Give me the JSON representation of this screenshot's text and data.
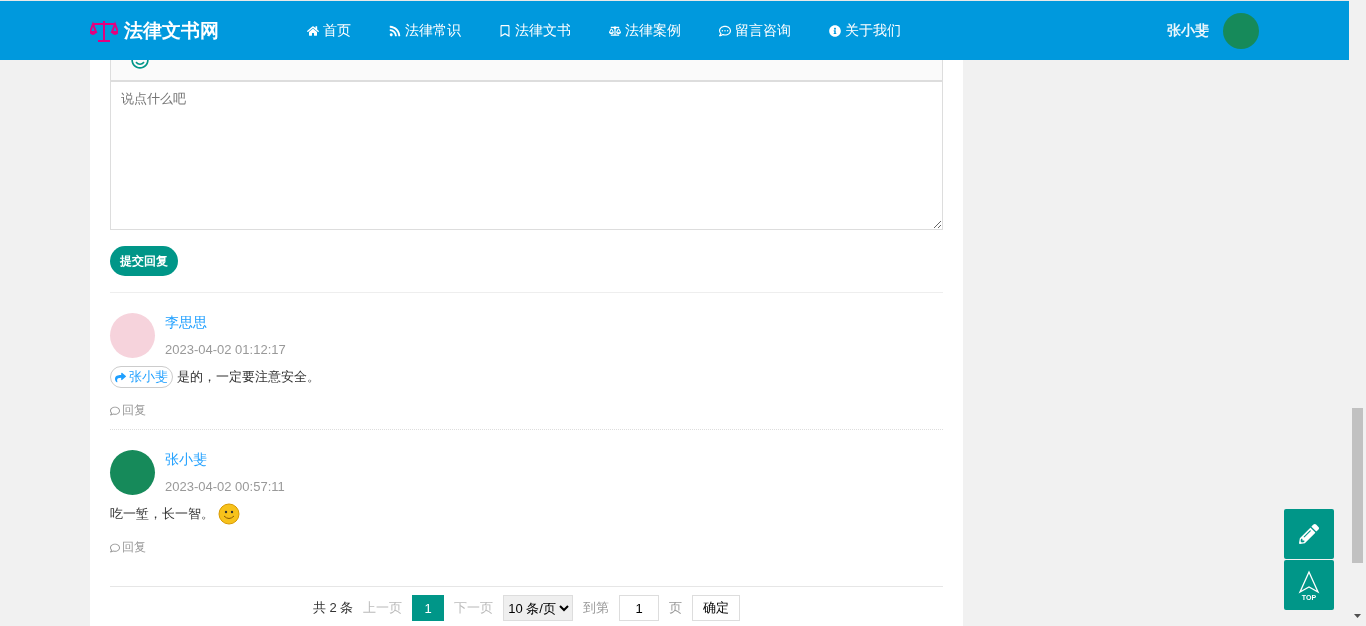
{
  "header": {
    "logo": "法律文书网",
    "nav": [
      {
        "label": "首页"
      },
      {
        "label": "法律常识"
      },
      {
        "label": "法律文书"
      },
      {
        "label": "法律案例"
      },
      {
        "label": "留言咨询"
      },
      {
        "label": "关于我们"
      }
    ],
    "user": "张小斐"
  },
  "editor": {
    "placeholder": "说点什么吧",
    "submit": "提交回复"
  },
  "comments": [
    {
      "author": "李思思",
      "time": "2023-04-02 01:12:17",
      "reply_to": "张小斐",
      "text": "是的，一定要注意安全。",
      "emoji": false,
      "reply": "回复"
    },
    {
      "author": "张小斐",
      "time": "2023-04-02 00:57:11",
      "text": "吃一堑，长一智。",
      "emoji": true,
      "reply": "回复"
    }
  ],
  "pagination": {
    "total": "共 2 条",
    "prev": "上一页",
    "pages": [
      {
        "label": "1",
        "selected": true
      }
    ],
    "next": "下一页",
    "page_size": "10 条/页",
    "goto_label": "到第",
    "goto_value": "1",
    "page_unit": "页",
    "confirm": "确定"
  },
  "float_buttons": {
    "top": "TOP"
  }
}
